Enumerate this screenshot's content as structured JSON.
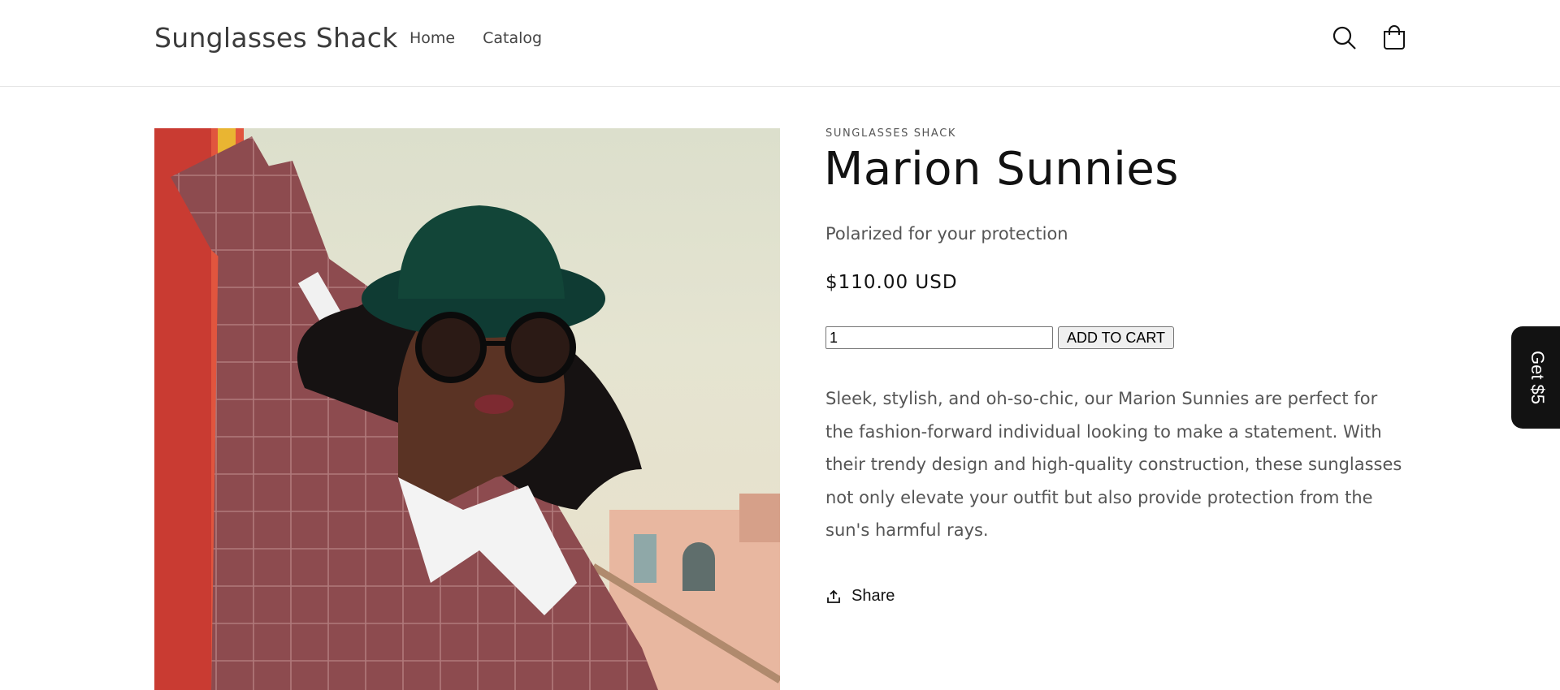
{
  "header": {
    "brand": "Sunglasses Shack",
    "nav": [
      {
        "label": "Home"
      },
      {
        "label": "Catalog"
      }
    ],
    "icons": [
      "search-icon",
      "cart-icon"
    ]
  },
  "product": {
    "vendor": "SUNGLASSES SHACK",
    "title": "Marion Sunnies",
    "subtitle": "Polarized for your protection",
    "price": "$110.00 USD",
    "quantity": "1",
    "add_to_cart_label": "ADD TO CART",
    "description": "Sleek, stylish, and oh-so-chic, our Marion Sunnies are perfect for the fashion-forward individual looking to make a statement. With their trendy design and high-quality construction, these sunglasses not only elevate your outfit but also provide protection from the sun's harmful rays.",
    "share_label": "Share"
  },
  "side_tab": {
    "label": "Get $5"
  },
  "colors": {
    "text": "#121212",
    "muted": "#555555",
    "side_tab_bg": "#121212"
  }
}
